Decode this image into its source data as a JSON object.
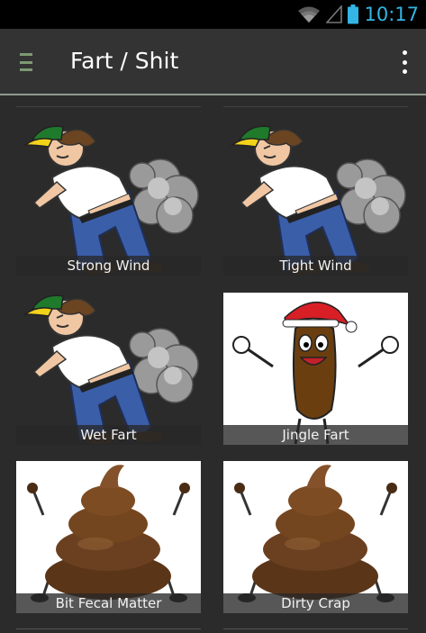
{
  "status_bar": {
    "time": "10:17",
    "icons": [
      "wifi-icon",
      "signal-icon",
      "battery-icon"
    ],
    "accent_color": "#33b5e5"
  },
  "action_bar": {
    "title": "Fart / Shit",
    "left_icon": "drawer-icon",
    "right_icon": "overflow-menu-icon",
    "divider_color": "#8f9a8c"
  },
  "sounds": [
    {
      "label": "Strong Wind",
      "image": "farting-man"
    },
    {
      "label": "Tight Wind",
      "image": "farting-man"
    },
    {
      "label": "Wet Fart",
      "image": "farting-man"
    },
    {
      "label": "Jingle Fart",
      "image": "poop-santa-hat"
    },
    {
      "label": "Bit Fecal Matter",
      "image": "poop-character"
    },
    {
      "label": "Dirty Crap",
      "image": "poop-character"
    }
  ]
}
